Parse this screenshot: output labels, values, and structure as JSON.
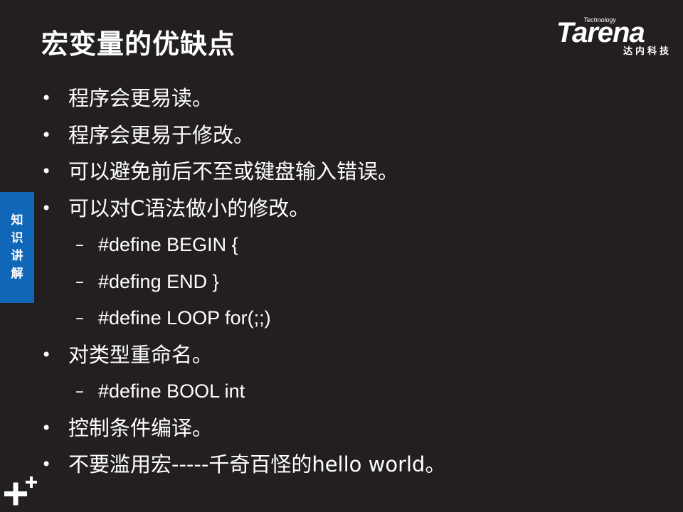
{
  "slide": {
    "title": "宏变量的优缺点",
    "logo": {
      "tech": "Technology",
      "word": "Tarena",
      "cn": "达内科技"
    },
    "side_tab": [
      "知",
      "识",
      "讲",
      "解"
    ],
    "bullet_marker": "•",
    "sub_marker": "–",
    "items": [
      {
        "level": 1,
        "text": "程序会更易读。"
      },
      {
        "level": 1,
        "text": "程序会更易于修改。"
      },
      {
        "level": 1,
        "text": "可以避免前后不至或键盘输入错误。"
      },
      {
        "level": 1,
        "text": "可以对C语法做小的修改。"
      },
      {
        "level": 2,
        "text": "#define BEGIN {"
      },
      {
        "level": 2,
        "text": "#defing END }"
      },
      {
        "level": 2,
        "text": "#define LOOP for(;;)"
      },
      {
        "level": 1,
        "text": "对类型重命名。"
      },
      {
        "level": 2,
        "text": "#define BOOL int"
      },
      {
        "level": 1,
        "text": "控制条件编译。"
      },
      {
        "level": 1,
        "text": "不要滥用宏-----千奇百怪的hello world。"
      }
    ]
  },
  "colors": {
    "background": "#231f20",
    "text": "#ffffff",
    "side_tab": "#1167b7"
  },
  "icons": {
    "corner": "plus-icon"
  }
}
